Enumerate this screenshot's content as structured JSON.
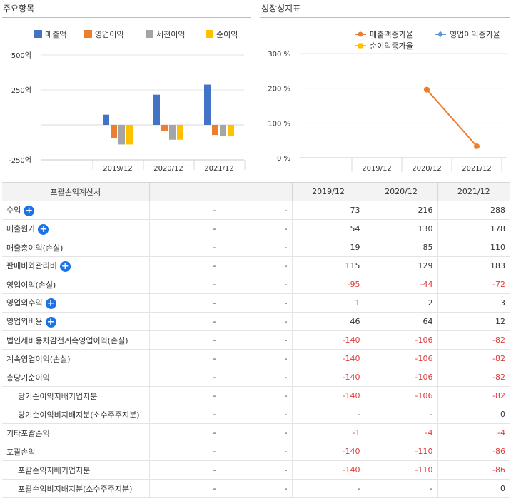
{
  "left_panel": {
    "title": "주요항목"
  },
  "right_panel": {
    "title": "성장성지표"
  },
  "left_chart": {
    "type": "bar",
    "categories": [
      "2019/12",
      "2020/12",
      "2021/12"
    ],
    "series": [
      {
        "name": "매출액",
        "color": "#4472c4",
        "values": [
          73,
          216,
          288
        ]
      },
      {
        "name": "영업이익",
        "color": "#ed7d31",
        "values": [
          -95,
          -44,
          -72
        ]
      },
      {
        "name": "세전이익",
        "color": "#a5a5a5",
        "values": [
          -140,
          -106,
          -82
        ]
      },
      {
        "name": "순이익",
        "color": "#ffc000",
        "values": [
          -140,
          -106,
          -82
        ]
      }
    ],
    "ytick_labels": [
      "500억",
      "250억",
      "",
      "-250억"
    ],
    "ytick_values": [
      500,
      250,
      0,
      -250
    ],
    "ylim": [
      -250,
      500
    ]
  },
  "right_chart": {
    "type": "line",
    "categories": [
      "2019/12",
      "2020/12",
      "2021/12"
    ],
    "series": [
      {
        "name": "매출액증가율",
        "color": "#ed7d31",
        "values": [
          null,
          196,
          33
        ]
      },
      {
        "name": "영업이익증가율",
        "color": "#5b9bd5",
        "values": [
          null,
          null,
          null
        ]
      },
      {
        "name": "순이익증가율",
        "color": "#ffc000",
        "values": [
          null,
          null,
          null
        ]
      }
    ],
    "ytick_labels": [
      "300 %",
      "200 %",
      "100 %",
      "0 %"
    ],
    "ytick_values": [
      300,
      200,
      100,
      0
    ],
    "ylim": [
      0,
      300
    ]
  },
  "table": {
    "header": [
      "포괄손익계산서",
      "",
      "",
      "2019/12",
      "2020/12",
      "2021/12"
    ],
    "rows": [
      {
        "label": "수익",
        "plus": true,
        "indent": false,
        "c2": "-",
        "c3": "-",
        "v": [
          "73",
          "216",
          "288"
        ]
      },
      {
        "label": "매출원가",
        "plus": true,
        "indent": false,
        "c2": "-",
        "c3": "-",
        "v": [
          "54",
          "130",
          "178"
        ]
      },
      {
        "label": "매출총이익(손실)",
        "plus": false,
        "indent": false,
        "c2": "-",
        "c3": "-",
        "v": [
          "19",
          "85",
          "110"
        ]
      },
      {
        "label": "판매비와관리비",
        "plus": true,
        "indent": false,
        "c2": "-",
        "c3": "-",
        "v": [
          "115",
          "129",
          "183"
        ]
      },
      {
        "label": "영업이익(손실)",
        "plus": false,
        "indent": false,
        "c2": "-",
        "c3": "-",
        "v": [
          "-95",
          "-44",
          "-72"
        ]
      },
      {
        "label": "영업외수익",
        "plus": true,
        "indent": false,
        "c2": "-",
        "c3": "-",
        "v": [
          "1",
          "2",
          "3"
        ]
      },
      {
        "label": "영업외비용",
        "plus": true,
        "indent": false,
        "c2": "-",
        "c3": "-",
        "v": [
          "46",
          "64",
          "12"
        ]
      },
      {
        "label": "법인세비용차감전계속영업이익(손실)",
        "plus": false,
        "indent": false,
        "c2": "-",
        "c3": "-",
        "v": [
          "-140",
          "-106",
          "-82"
        ]
      },
      {
        "label": "계속영업이익(손실)",
        "plus": false,
        "indent": false,
        "c2": "-",
        "c3": "-",
        "v": [
          "-140",
          "-106",
          "-82"
        ]
      },
      {
        "label": "총당기순이익",
        "plus": false,
        "indent": false,
        "c2": "-",
        "c3": "-",
        "v": [
          "-140",
          "-106",
          "-82"
        ]
      },
      {
        "label": "당기순이익지배기업지분",
        "plus": false,
        "indent": true,
        "c2": "-",
        "c3": "-",
        "v": [
          "-140",
          "-106",
          "-82"
        ]
      },
      {
        "label": "당기순이익비지배지분(소수주주지분)",
        "plus": false,
        "indent": true,
        "c2": "-",
        "c3": "-",
        "v": [
          "-",
          "-",
          "0"
        ]
      },
      {
        "label": "기타포괄손익",
        "plus": false,
        "indent": false,
        "c2": "-",
        "c3": "-",
        "v": [
          "-1",
          "-4",
          "-4"
        ]
      },
      {
        "label": "포괄손익",
        "plus": false,
        "indent": false,
        "c2": "-",
        "c3": "-",
        "v": [
          "-140",
          "-110",
          "-86"
        ]
      },
      {
        "label": "포괄손익지배기업지분",
        "plus": false,
        "indent": true,
        "c2": "-",
        "c3": "-",
        "v": [
          "-140",
          "-110",
          "-86"
        ]
      },
      {
        "label": "포괄손익비지배지분(소수주주지분)",
        "plus": false,
        "indent": true,
        "c2": "-",
        "c3": "-",
        "v": [
          "-",
          "-",
          "0"
        ]
      }
    ]
  }
}
